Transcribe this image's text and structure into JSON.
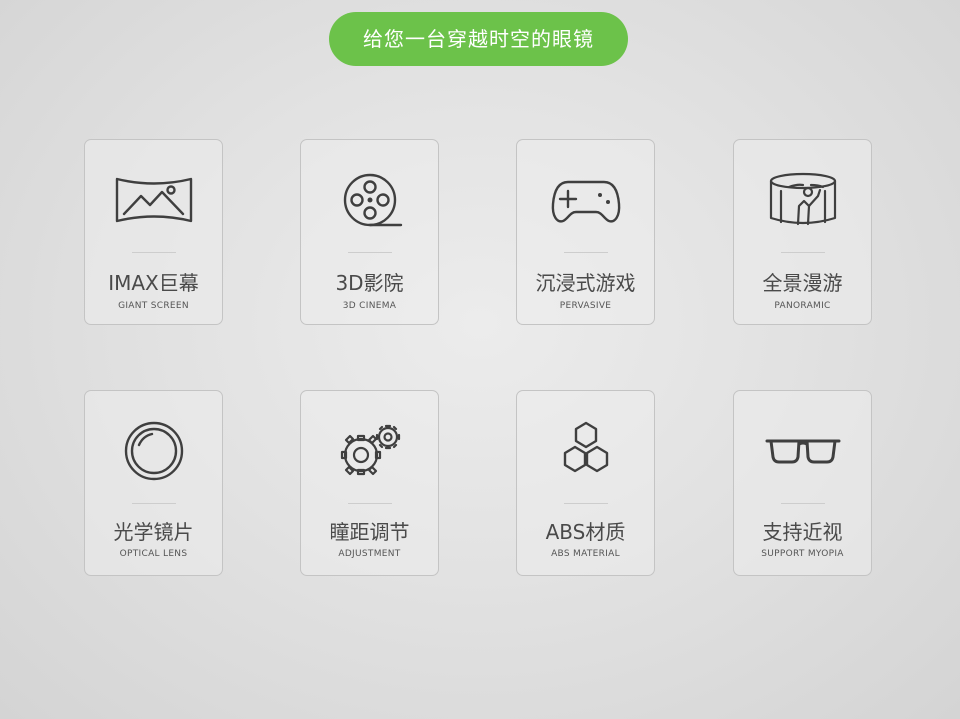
{
  "banner": {
    "text": "给您一台穿越时空的眼镜"
  },
  "features": [
    {
      "title": "IMAX巨幕",
      "subtitle": "GIANT SCREEN",
      "icon": "panorama-screen-icon"
    },
    {
      "title": "3D影院",
      "subtitle": "3D CINEMA",
      "icon": "film-reel-icon"
    },
    {
      "title": "沉浸式游戏",
      "subtitle": "PERVASIVE",
      "icon": "gamepad-icon"
    },
    {
      "title": "全景漫游",
      "subtitle": "PANORAMIC",
      "icon": "panoramic-roaming-icon"
    },
    {
      "title": "光学镜片",
      "subtitle": "OPTICAL LENS",
      "icon": "lens-icon"
    },
    {
      "title": "瞳距调节",
      "subtitle": "ADJUSTMENT",
      "icon": "gears-icon"
    },
    {
      "title": "ABS材质",
      "subtitle": "ABS MATERIAL",
      "icon": "hexagon-cells-icon"
    },
    {
      "title": "支持近视",
      "subtitle": "SUPPORT MYOPIA",
      "icon": "glasses-icon"
    }
  ],
  "colors": {
    "accent": "#6cc24a",
    "icon": "#3f3f3f",
    "border": "#c4c4c4",
    "text": "#4a4a4a"
  }
}
